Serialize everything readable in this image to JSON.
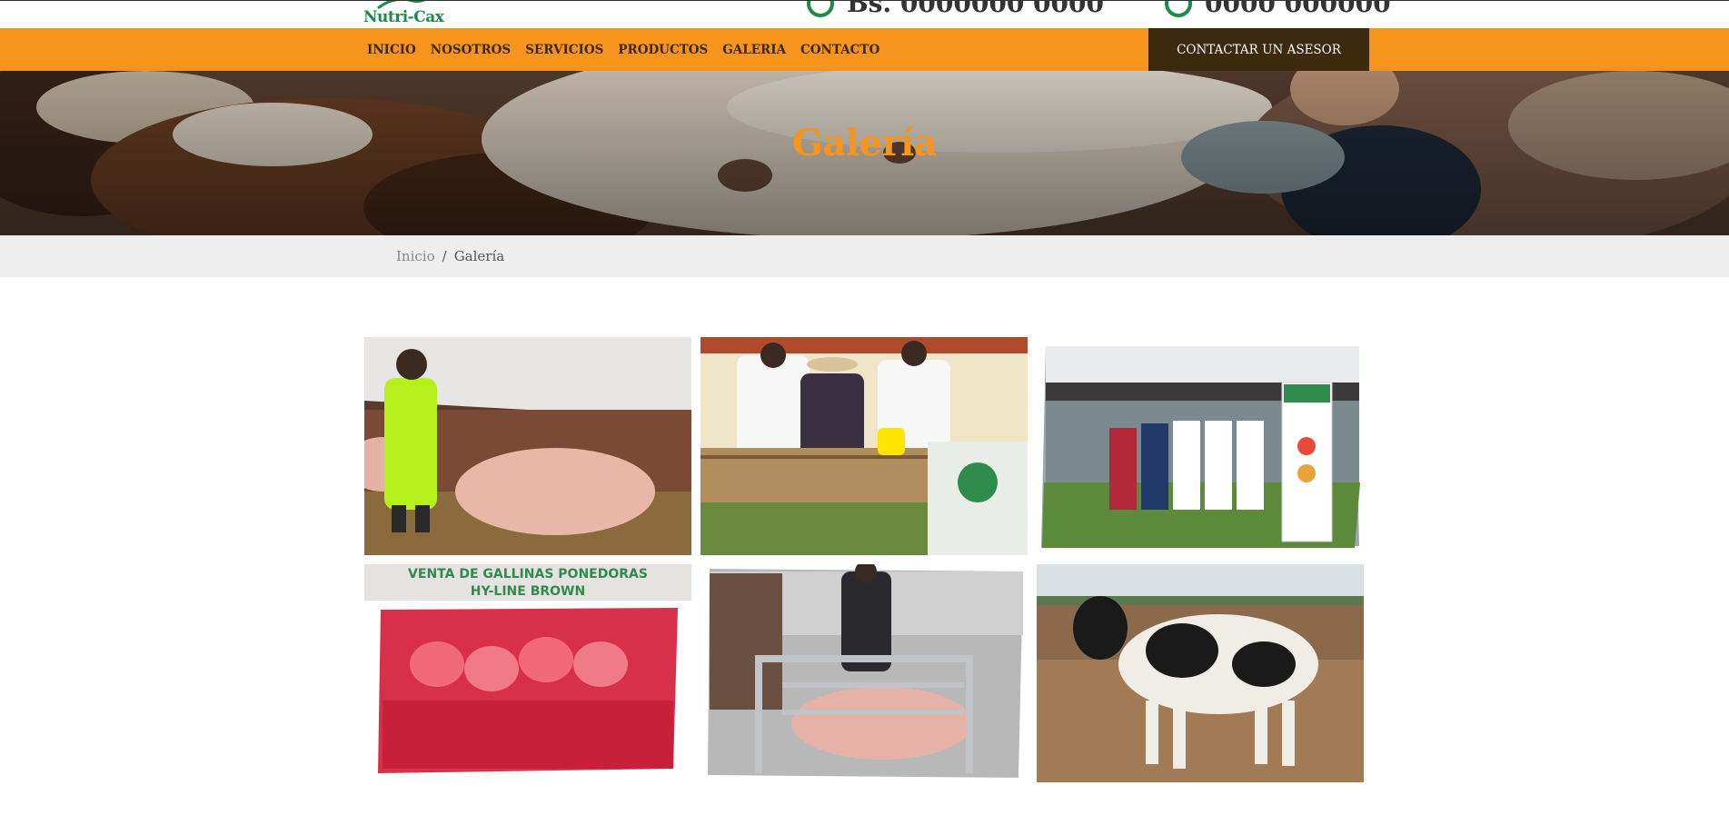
{
  "brand": {
    "logo_text": "Nutri-Cax"
  },
  "header": {
    "contact_1": "Bs. 0000000 0000",
    "contact_2": "0000 000000"
  },
  "nav": {
    "items": [
      "INICIO",
      "NOSOTROS",
      "SERVICIOS",
      "PRODUCTOS",
      "GALERIA",
      "CONTACTO"
    ],
    "cta_label": "CONTACTAR UN ASESOR"
  },
  "hero": {
    "title": "Galería"
  },
  "breadcrumb": {
    "home": "Inicio",
    "separator": "/",
    "current": "Galería"
  },
  "gallery": {
    "poster_line_1": "VENTA DE GALLINAS PONEDORAS",
    "poster_line_2": "HY-LINE BROWN",
    "items": [
      {
        "subject": "man-with-pigs"
      },
      {
        "subject": "team-with-feed-sacks"
      },
      {
        "subject": "group-with-banner"
      },
      {
        "subject": "hens-poster"
      },
      {
        "subject": "man-with-pig-crate"
      },
      {
        "subject": "holstein-bull"
      }
    ]
  },
  "colors": {
    "nav_orange": "#f7941d",
    "cta_dark": "#3d2a0e",
    "brand_green": "#1e8a4a",
    "breadcrumb_bg": "#eeeeee"
  }
}
